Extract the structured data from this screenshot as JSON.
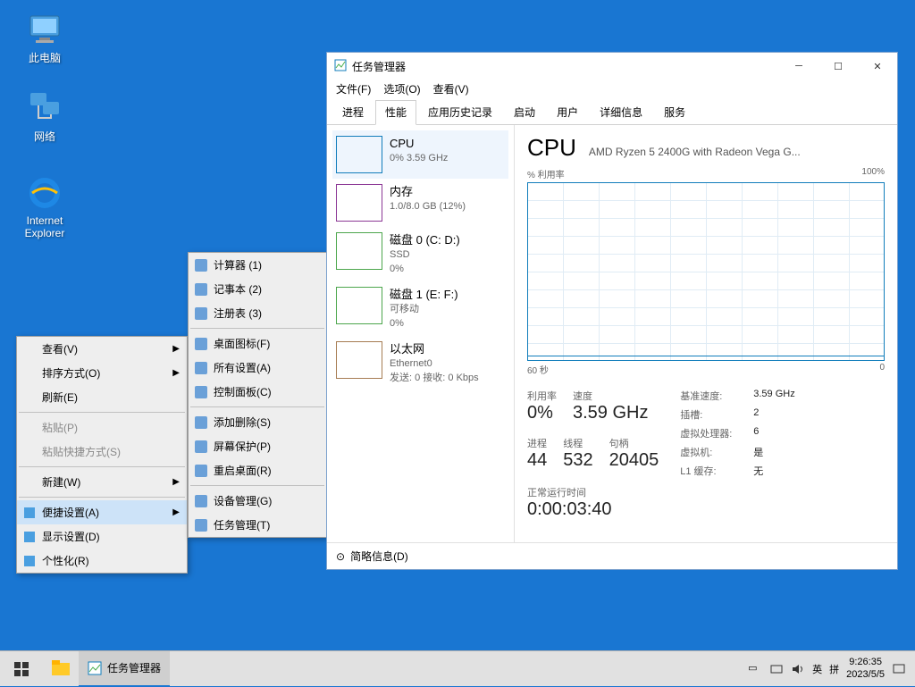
{
  "desktop": {
    "icons": [
      {
        "name": "此电脑"
      },
      {
        "name": "网络"
      },
      {
        "name": "Internet\nExplorer"
      }
    ]
  },
  "context_menu_1": {
    "items": [
      {
        "label": "查看(V)",
        "arrow": true
      },
      {
        "label": "排序方式(O)",
        "arrow": true
      },
      {
        "label": "刷新(E)"
      },
      {
        "sep": true
      },
      {
        "label": "粘贴(P)",
        "disabled": true
      },
      {
        "label": "粘贴快捷方式(S)",
        "disabled": true
      },
      {
        "sep": true
      },
      {
        "label": "新建(W)",
        "arrow": true
      },
      {
        "sep": true
      },
      {
        "label": "便捷设置(A)",
        "arrow": true,
        "highlighted": true,
        "icon": "settings"
      },
      {
        "label": "显示设置(D)",
        "icon": "display"
      },
      {
        "label": "个性化(R)",
        "icon": "personalize"
      }
    ]
  },
  "context_menu_2": {
    "items": [
      {
        "label": "计算器  (1)",
        "icon": "calc"
      },
      {
        "label": "记事本  (2)",
        "icon": "notepad"
      },
      {
        "label": "注册表  (3)",
        "icon": "regedit"
      },
      {
        "sep": true
      },
      {
        "label": "桌面图标(F)",
        "icon": "desktop-icons"
      },
      {
        "label": "所有设置(A)",
        "icon": "settings"
      },
      {
        "label": "控制面板(C)",
        "icon": "control"
      },
      {
        "sep": true
      },
      {
        "label": "添加删除(S)",
        "icon": "programs"
      },
      {
        "label": "屏幕保护(P)",
        "icon": "screensaver"
      },
      {
        "label": "重启桌面(R)",
        "icon": "restart"
      },
      {
        "sep": true
      },
      {
        "label": "设备管理(G)",
        "icon": "devmgr"
      },
      {
        "label": "任务管理(T)",
        "icon": "taskmgr"
      }
    ]
  },
  "taskmgr": {
    "title": "任务管理器",
    "menus": [
      "文件(F)",
      "选项(O)",
      "查看(V)"
    ],
    "tabs": [
      "进程",
      "性能",
      "应用历史记录",
      "启动",
      "用户",
      "详细信息",
      "服务"
    ],
    "active_tab": 1,
    "perf_items": [
      {
        "kind": "cpu",
        "title": "CPU",
        "sub": "0% 3.59 GHz"
      },
      {
        "kind": "mem",
        "title": "内存",
        "sub": "1.0/8.0 GB (12%)"
      },
      {
        "kind": "disk",
        "title": "磁盘 0 (C: D:)",
        "sub": "SSD",
        "sub2": "0%"
      },
      {
        "kind": "disk",
        "title": "磁盘 1 (E: F:)",
        "sub": "可移动",
        "sub2": "0%"
      },
      {
        "kind": "eth",
        "title": "以太网",
        "sub": "Ethernet0",
        "sub2": "发送: 0 接收: 0 Kbps"
      }
    ],
    "right": {
      "heading": "CPU",
      "subtitle": "AMD Ryzen 5 2400G with Radeon Vega G...",
      "graph_label_left": "% 利用率",
      "graph_label_right": "100%",
      "xaxis_left": "60 秒",
      "xaxis_right": "0",
      "stats_top": [
        {
          "label": "利用率",
          "value": "0%"
        },
        {
          "label": "速度",
          "value": "3.59 GHz"
        }
      ],
      "stats_mid": [
        {
          "label": "进程",
          "value": "44"
        },
        {
          "label": "线程",
          "value": "532"
        },
        {
          "label": "句柄",
          "value": "20405"
        }
      ],
      "stats_right": [
        {
          "label": "基准速度:",
          "value": "3.59 GHz"
        },
        {
          "label": "插槽:",
          "value": "2"
        },
        {
          "label": "虚拟处理器:",
          "value": "6"
        },
        {
          "label": "虚拟机:",
          "value": "是"
        },
        {
          "label": "L1 缓存:",
          "value": "无"
        }
      ],
      "uptime_label": "正常运行时间",
      "uptime_value": "0:00:03:40"
    },
    "footer": "简略信息(D)"
  },
  "taskbar": {
    "apps": [
      {
        "label": "",
        "kind": "explorer"
      },
      {
        "label": "任务管理器",
        "kind": "taskmgr",
        "active": true
      }
    ],
    "tray": {
      "ime1": "英",
      "ime2": "拼",
      "time": "9:26:35",
      "date": "2023/5/5"
    }
  }
}
